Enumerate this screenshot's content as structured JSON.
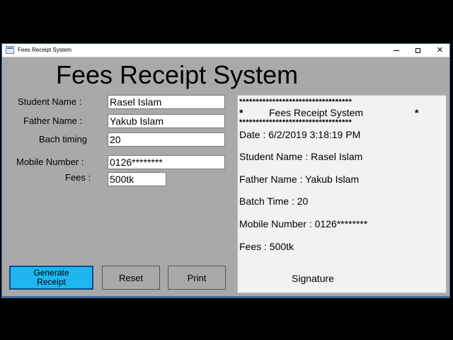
{
  "window": {
    "title": "Fees Receipt System",
    "controls": {
      "minimize_icon": "minimize-icon",
      "maximize_icon": "maximize-icon",
      "close_glyph": "✕"
    }
  },
  "heading": "Fees Receipt System",
  "form": {
    "student_name": {
      "label": "Student Name :",
      "value": "Rasel Islam"
    },
    "father_name": {
      "label": "Father Name :",
      "value": "Yakub Islam"
    },
    "batch_timing": {
      "label": "Bach timing",
      "value": "20"
    },
    "mobile_number": {
      "label": "Mobile Number :",
      "value": "0126********"
    },
    "fees": {
      "label": "Fees :",
      "value": "500tk"
    }
  },
  "buttons": {
    "generate_line1": "Generate",
    "generate_line2": "Receipt",
    "reset": "Reset",
    "print": "Print"
  },
  "receipt": {
    "stars_top": "**********************************",
    "title_star_left": "*",
    "title": "Fees Receipt System",
    "title_star_right": "*",
    "stars_bottom": "**********************************",
    "date": "Date : 6/2/2019 3:18:19 PM",
    "student_name": "Student Name : Rasel Islam",
    "father_name": "Father Name : Yakub Islam",
    "batch_time": "Batch Time : 20",
    "mobile_number": "Mobile Number : 0126********",
    "fees": "Fees : 500tk",
    "signature": "Signature"
  },
  "colors": {
    "window_background": "#a9a9a9",
    "accent_button": "#1fb6f0",
    "receipt_background": "#f2f2f2"
  }
}
